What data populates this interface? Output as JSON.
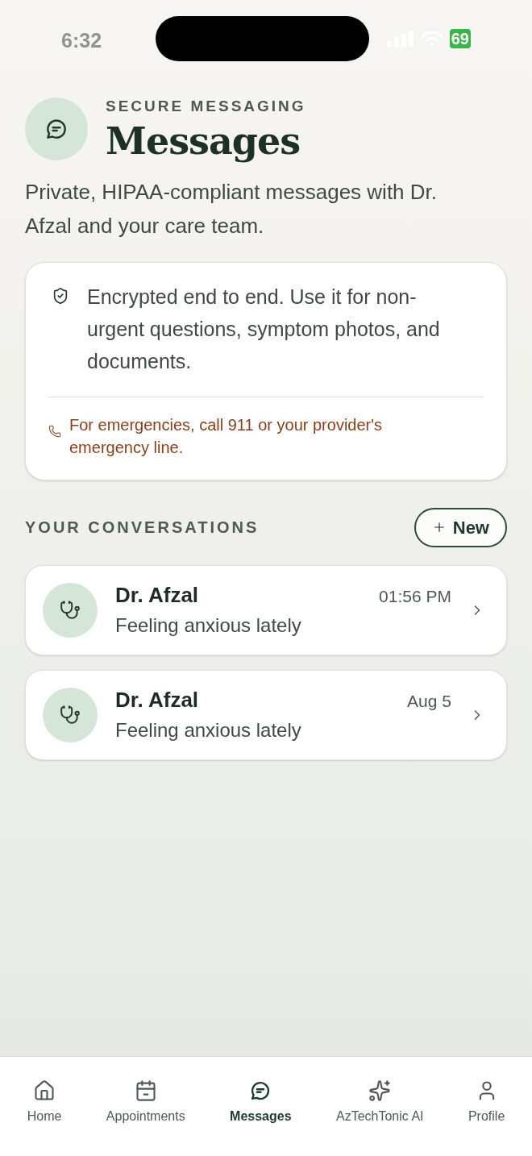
{
  "status_bar": {
    "time": "6:32",
    "battery": "69"
  },
  "header": {
    "eyebrow": "SECURE MESSAGING",
    "title": "Messages",
    "subtitle": "Private, HIPAA-compliant messages with Dr. Afzal and your care team."
  },
  "notice": {
    "text": "Encrypted end to end. Use it for non-urgent questions, symptom photos, and documents.",
    "warning": "For emergencies, call 911 or your provider's emergency line."
  },
  "conversations": {
    "heading": "YOUR CONVERSATIONS",
    "new_button": "New",
    "items": [
      {
        "name": "Dr. Afzal",
        "preview": "Feeling anxious lately",
        "time": "01:56 PM"
      },
      {
        "name": "Dr. Afzal",
        "preview": "Feeling anxious lately",
        "time": "Aug 5"
      }
    ]
  },
  "tab_bar": [
    {
      "kind": "home",
      "label": "Home",
      "selected": false
    },
    {
      "kind": "calendar",
      "label": "Appointments",
      "selected": false
    },
    {
      "kind": "messages",
      "label": "Messages",
      "selected": true
    },
    {
      "kind": "ai",
      "label": "AzTechTonic AI",
      "selected": false
    },
    {
      "kind": "profile",
      "label": "Profile",
      "selected": false
    }
  ]
}
